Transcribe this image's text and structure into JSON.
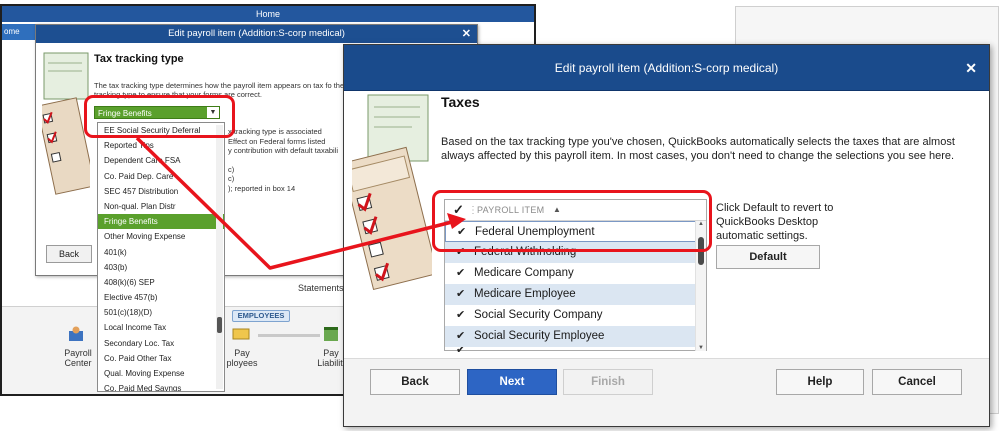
{
  "home_window": {
    "title": "Home",
    "tab_label": "ome Pag",
    "employees_badge": "EMPLOYEES",
    "payroll_center_label": "Payroll\nCenter",
    "pay_employees_label": "Pay\nployees",
    "pay_liabilities_label": "Pay\nLiabiliti",
    "statements_label": "Statements"
  },
  "left_dialog": {
    "title": "Edit payroll item (Addition:S-corp medical)",
    "heading": "Tax tracking type",
    "description": "The tax tracking type determines how the payroll item appears on tax fo the correct tax tracking type to ensure that your forms are correct.",
    "selected_value": "Fringe Benefits",
    "tracking_notes": [
      "x tracking type is associated",
      "Effect on Federal forms listed",
      "y contribution with default taxabili",
      "",
      "c)",
      "c)",
      "); reported in box 14"
    ],
    "back_label": "Back",
    "dropdown_items": [
      "EE Social Security Deferral",
      "Reported Tips",
      "Dependent Care FSA",
      "Co. Paid Dep. Care",
      "SEC 457 Distribution",
      "Non-qual. Plan Distr",
      "Fringe Benefits",
      "Other Moving Expense",
      "401(k)",
      "403(b)",
      "408(k)(6) SEP",
      "Elective 457(b)",
      "501(c)(18)(D)",
      "Local Income Tax",
      "Secondary Loc. Tax",
      "Co. Paid Other Tax",
      "Qual. Moving Expense",
      "Co. Paid Med Savngs"
    ],
    "dropdown_selected_index": 6
  },
  "right_dialog": {
    "title": "Edit payroll item (Addition:S-corp medical)",
    "heading": "Taxes",
    "description": "Based on the tax tracking type you've chosen, QuickBooks automatically selects the taxes that are almost always affected by this payroll item.  In most cases, you don't need to change the selections you see here.",
    "list": {
      "header_check": "✓",
      "column_label": "PAYROLL ITEM",
      "sort_indicator": "▲",
      "rows": [
        {
          "checked": "✔",
          "name": "Federal Unemployment"
        },
        {
          "checked": "✔",
          "name": "Federal Withholding"
        },
        {
          "checked": "✔",
          "name": "Medicare Company"
        },
        {
          "checked": "✔",
          "name": "Medicare Employee"
        },
        {
          "checked": "✔",
          "name": "Social Security Company"
        },
        {
          "checked": "✔",
          "name": "Social Security Employee"
        },
        {
          "checked": "✔",
          "name": ""
        }
      ]
    },
    "default_text": "Click Default to revert to QuickBooks Desktop automatic settings.",
    "default_button": "Default",
    "buttons": {
      "back": "Back",
      "next": "Next",
      "finish": "Finish",
      "help": "Help",
      "cancel": "Cancel"
    }
  },
  "colors": {
    "title_bar": "#1a4b8c",
    "selection_green": "#5aa02c",
    "primary_button": "#2d65c4",
    "annotation_red": "#e8141c",
    "row_highlight": "#dbe6f2"
  }
}
